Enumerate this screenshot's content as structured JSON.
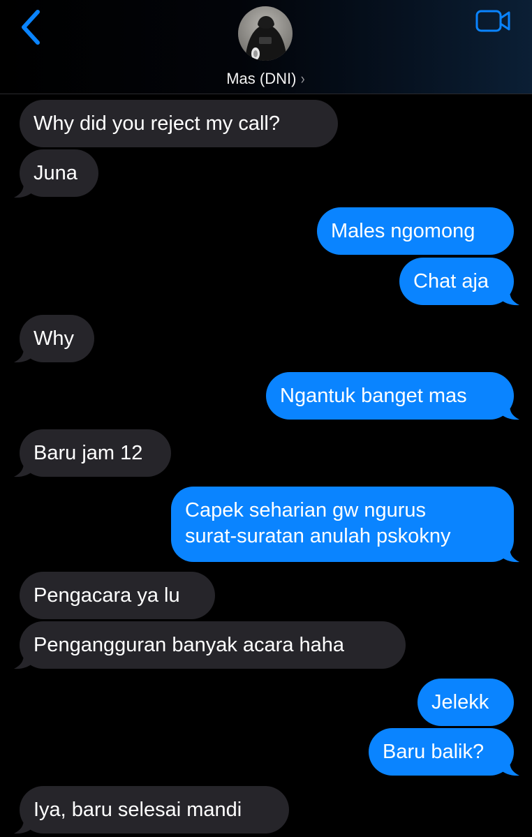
{
  "header": {
    "contact_name": "Mas (DNI)",
    "chevron": "›",
    "back_icon": "chevron-left-icon",
    "video_icon": "video-camera-icon",
    "accent_color": "#0a84ff"
  },
  "colors": {
    "incoming_bubble": "#26252a",
    "outgoing_bubble": "#0a84ff",
    "background": "#000000"
  },
  "messages": [
    {
      "direction": "in",
      "text": "Why did you reject my call?"
    },
    {
      "direction": "in",
      "text": "Juna"
    },
    {
      "direction": "out",
      "text": "Males ngomong"
    },
    {
      "direction": "out",
      "text": "Chat aja"
    },
    {
      "direction": "in",
      "text": "Why"
    },
    {
      "direction": "out",
      "text": "Ngantuk banget mas"
    },
    {
      "direction": "in",
      "text": "Baru jam 12"
    },
    {
      "direction": "out",
      "lines": [
        "Capek seharian gw ngurus",
        "surat-suratan anulah pskokny"
      ]
    },
    {
      "direction": "in",
      "text": "Pengacara ya lu"
    },
    {
      "direction": "in",
      "text": "Pengangguran banyak acara haha"
    },
    {
      "direction": "out",
      "text": "Jelekk"
    },
    {
      "direction": "out",
      "text": "Baru balik?"
    },
    {
      "direction": "in",
      "text": "Iya, baru selesai mandi"
    }
  ]
}
